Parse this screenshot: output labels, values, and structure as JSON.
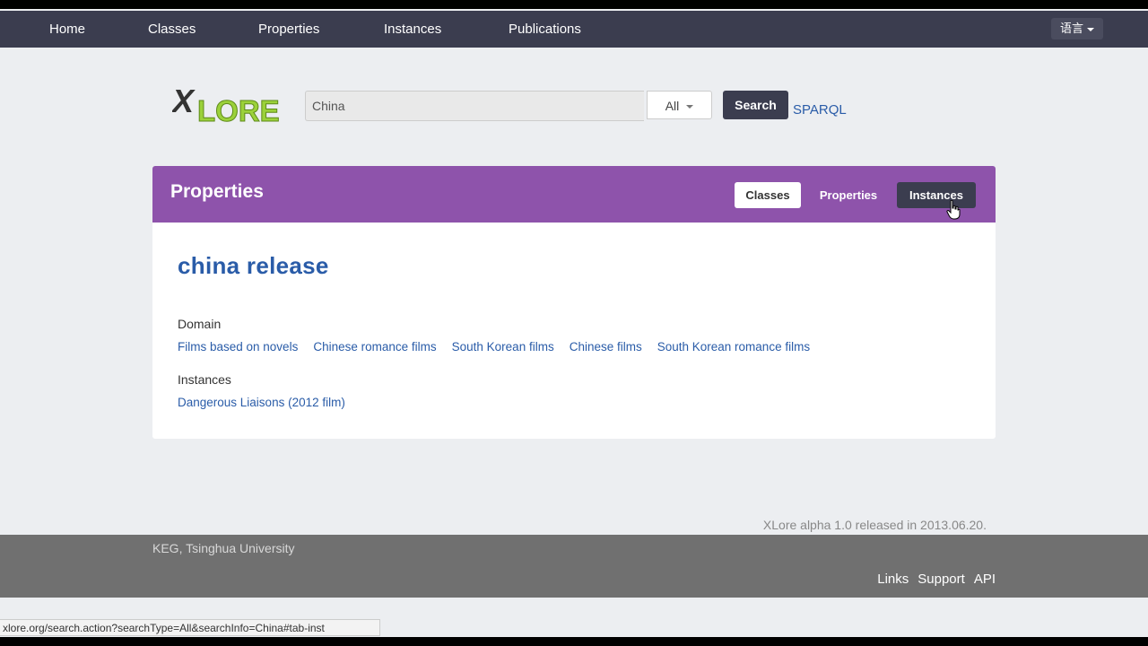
{
  "nav": {
    "items": [
      "Home",
      "Classes",
      "Properties",
      "Instances",
      "Publications"
    ],
    "lang_label": "语言"
  },
  "logo": {
    "text_x": "X",
    "text_lore": "LORE"
  },
  "search": {
    "value": "China",
    "type_selected": "All",
    "button_label": "Search",
    "sparql_link": "SPARQL"
  },
  "panel": {
    "title": "Properties",
    "tabs": [
      "Classes",
      "Properties",
      "Instances"
    ],
    "active_tab": "Instances",
    "property_name": "china release",
    "domain_label": "Domain",
    "domain_links": [
      "Films based on novels",
      "Chinese romance films",
      "South Korean films",
      "Chinese films",
      "South Korean romance films"
    ],
    "instances_label": "Instances",
    "instance_links": [
      "Dangerous Liaisons (2012 film)"
    ]
  },
  "release_note": "XLore alpha 1.0 released in 2013.06.20.",
  "footer": {
    "org": "KEG, Tsinghua University",
    "links": [
      "Links",
      "Support",
      "API"
    ]
  },
  "statusbar": "xlore.org/search.action?searchType=All&searchInfo=China#tab-inst",
  "colors": {
    "navbar": "#3b3d4f",
    "panel_header": "#8e53ab",
    "link": "#2a5ca8",
    "logo_green": "#9bd13a"
  }
}
